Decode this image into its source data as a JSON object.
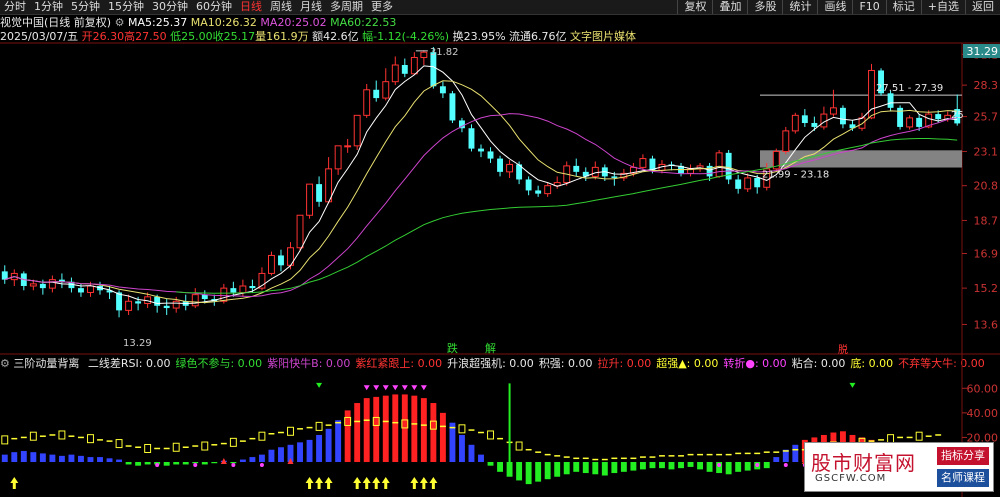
{
  "tabs": [
    {
      "label": "分时",
      "active": false
    },
    {
      "label": "1分钟",
      "active": false
    },
    {
      "label": "5分钟",
      "active": false
    },
    {
      "label": "15分钟",
      "active": false
    },
    {
      "label": "30分钟",
      "active": false
    },
    {
      "label": "60分钟",
      "active": false
    },
    {
      "label": "日线",
      "active": true
    },
    {
      "label": "周线",
      "active": false
    },
    {
      "label": "月线",
      "active": false
    },
    {
      "label": "多周期",
      "active": false
    },
    {
      "label": "更多",
      "active": false
    }
  ],
  "tools": [
    "复权",
    "叠加",
    "多股",
    "统计",
    "画线",
    "F10",
    "标记",
    "+自选",
    "返回"
  ],
  "title": {
    "name": "视觉中国(日线 前复权)",
    "ma5_label": "MA5:",
    "ma5": "25.37",
    "ma10_label": "MA10:",
    "ma10": "26.32",
    "ma20_label": "MA20:",
    "ma20": "25.02",
    "ma60_label": "MA60:",
    "ma60": "22.53"
  },
  "quote": {
    "date": "2025/03/07/五",
    "open_label": "开",
    "open": "26.30",
    "high_label": "高",
    "high": "27.50",
    "low_label": "低",
    "low": "25.00",
    "close_label": "收",
    "close": "25.17",
    "vol_label": "量",
    "vol": "161.9万",
    "amt_label": "额",
    "amt": "42.6亿",
    "chg_label": "幅",
    "chg": "-1.12(-4.26%)",
    "turn_label": "换",
    "turn": "23.95%",
    "float_label": "流通",
    "float": "6.76亿",
    "concept": "文字图片媒体"
  },
  "indicator": {
    "name": "三阶动量背离",
    "items": [
      {
        "label": "二线差RSI: 0.00",
        "color": "#e8e8e8"
      },
      {
        "label": "绿色不参与: 0.00",
        "color": "#33dd33"
      },
      {
        "label": "紫阳快牛B: 0.00",
        "color": "#cc44cc"
      },
      {
        "label": "紫红紧跟上: 0.00",
        "color": "#ff3333"
      },
      {
        "label": "升浪超强机: 0.00",
        "color": "#e8e8e8"
      },
      {
        "label": "积强: 0.00",
        "color": "#e8e8e8"
      },
      {
        "label": "拉升: 0.00",
        "color": "#ff3333"
      },
      {
        "label": "超强▲: 0.00",
        "color": "#ffff33"
      },
      {
        "label": "转折●: 0.00",
        "color": "#ff44ff"
      },
      {
        "label": "粘合: 0.00",
        "color": "#e8e8e8"
      },
      {
        "label": "底: 0.00",
        "color": "#ffff33"
      },
      {
        "label": "不弃等大牛: 0.00",
        "color": "#ff3333"
      }
    ]
  },
  "price_axis": {
    "ticks": [
      "31.1",
      "28.3",
      "25.7",
      "23.1",
      "20.8",
      "18.7",
      "16.9",
      "15.2",
      "13.6"
    ],
    "current": "31.29"
  },
  "ind_axis": {
    "ticks": [
      "60.00",
      "40.00",
      "20.00"
    ]
  },
  "annotations": {
    "high": "31.82",
    "low": "13.29",
    "box_top": "27.51 - 27.39",
    "box_bottom": "21.99 - 23.18",
    "last": "25",
    "sig1": "跌",
    "sig2": "解",
    "sig3": "脱"
  },
  "logo": {
    "big": "股市财富网",
    "url": "GSCFW.COM",
    "btn1": "指标分享",
    "btn2": "名师课程"
  },
  "colors": {
    "up": "#ff3232",
    "down": "#54ffff",
    "ma5": "#ffffff",
    "ma10": "#e8e070",
    "ma20": "#cc44cc",
    "ma60": "#33cc33"
  },
  "chart_data": {
    "type": "candlestick",
    "period": "日线",
    "ylim": [
      12.5,
      32
    ],
    "candles": [
      {
        "o": 16.0,
        "c": 15.6,
        "h": 16.3,
        "l": 15.4
      },
      {
        "o": 15.6,
        "c": 15.9,
        "h": 16.1,
        "l": 15.3
      },
      {
        "o": 15.9,
        "c": 15.3,
        "h": 16.0,
        "l": 15.1
      },
      {
        "o": 15.3,
        "c": 15.4,
        "h": 15.6,
        "l": 15.1
      },
      {
        "o": 15.4,
        "c": 15.2,
        "h": 15.6,
        "l": 14.9
      },
      {
        "o": 15.2,
        "c": 15.6,
        "h": 15.8,
        "l": 15.0
      },
      {
        "o": 15.6,
        "c": 15.5,
        "h": 15.9,
        "l": 15.2
      },
      {
        "o": 15.5,
        "c": 15.2,
        "h": 15.7,
        "l": 15.0
      },
      {
        "o": 15.2,
        "c": 15.0,
        "h": 15.4,
        "l": 14.8
      },
      {
        "o": 15.0,
        "c": 15.3,
        "h": 15.5,
        "l": 14.8
      },
      {
        "o": 15.3,
        "c": 15.1,
        "h": 15.5,
        "l": 14.9
      },
      {
        "o": 15.1,
        "c": 15.0,
        "h": 15.3,
        "l": 14.7
      },
      {
        "o": 15.0,
        "c": 14.2,
        "h": 15.1,
        "l": 13.9
      },
      {
        "o": 14.2,
        "c": 14.6,
        "h": 14.9,
        "l": 14.0
      },
      {
        "o": 14.6,
        "c": 14.5,
        "h": 14.8,
        "l": 14.2
      },
      {
        "o": 14.5,
        "c": 14.8,
        "h": 15.0,
        "l": 14.3
      },
      {
        "o": 14.8,
        "c": 14.4,
        "h": 14.9,
        "l": 14.1
      },
      {
        "o": 14.4,
        "c": 14.3,
        "h": 14.7,
        "l": 14.0
      },
      {
        "o": 14.3,
        "c": 14.6,
        "h": 14.8,
        "l": 14.1
      },
      {
        "o": 14.6,
        "c": 14.4,
        "h": 14.9,
        "l": 14.2
      },
      {
        "o": 14.4,
        "c": 14.9,
        "h": 15.2,
        "l": 14.3
      },
      {
        "o": 14.9,
        "c": 14.7,
        "h": 15.1,
        "l": 14.5
      },
      {
        "o": 14.7,
        "c": 14.6,
        "h": 14.9,
        "l": 14.4
      },
      {
        "o": 14.6,
        "c": 15.2,
        "h": 15.4,
        "l": 14.5
      },
      {
        "o": 15.2,
        "c": 15.0,
        "h": 15.5,
        "l": 14.8
      },
      {
        "o": 15.0,
        "c": 15.3,
        "h": 15.6,
        "l": 14.8
      },
      {
        "o": 15.3,
        "c": 15.2,
        "h": 15.6,
        "l": 15.0
      },
      {
        "o": 15.2,
        "c": 15.9,
        "h": 16.2,
        "l": 15.1
      },
      {
        "o": 15.9,
        "c": 16.8,
        "h": 17.0,
        "l": 15.8
      },
      {
        "o": 16.8,
        "c": 16.3,
        "h": 17.1,
        "l": 16.0
      },
      {
        "o": 16.3,
        "c": 17.2,
        "h": 17.5,
        "l": 16.1
      },
      {
        "o": 17.2,
        "c": 19.0,
        "h": 19.0,
        "l": 17.0
      },
      {
        "o": 19.0,
        "c": 20.9,
        "h": 20.9,
        "l": 18.8
      },
      {
        "o": 20.9,
        "c": 19.8,
        "h": 21.4,
        "l": 19.5
      },
      {
        "o": 19.8,
        "c": 21.9,
        "h": 22.7,
        "l": 19.7
      },
      {
        "o": 21.9,
        "c": 23.5,
        "h": 23.5,
        "l": 21.5
      },
      {
        "o": 23.5,
        "c": 23.5,
        "h": 24.0,
        "l": 23.0
      },
      {
        "o": 23.5,
        "c": 25.8,
        "h": 25.8,
        "l": 23.2
      },
      {
        "o": 25.8,
        "c": 27.9,
        "h": 28.4,
        "l": 25.6
      },
      {
        "o": 27.9,
        "c": 27.2,
        "h": 28.7,
        "l": 26.9
      },
      {
        "o": 27.2,
        "c": 28.6,
        "h": 29.8,
        "l": 27.0
      },
      {
        "o": 28.6,
        "c": 30.1,
        "h": 30.9,
        "l": 28.3
      },
      {
        "o": 30.1,
        "c": 29.3,
        "h": 30.7,
        "l": 29.0
      },
      {
        "o": 29.3,
        "c": 30.8,
        "h": 31.3,
        "l": 29.2
      },
      {
        "o": 30.8,
        "c": 31.3,
        "h": 31.5,
        "l": 30.1
      },
      {
        "o": 31.3,
        "c": 28.2,
        "h": 31.8,
        "l": 28.0
      },
      {
        "o": 28.2,
        "c": 27.6,
        "h": 28.6,
        "l": 27.2
      },
      {
        "o": 27.6,
        "c": 25.4,
        "h": 27.8,
        "l": 25.2
      },
      {
        "o": 25.4,
        "c": 24.8,
        "h": 25.6,
        "l": 24.5
      },
      {
        "o": 24.8,
        "c": 23.3,
        "h": 25.1,
        "l": 23.1
      },
      {
        "o": 23.3,
        "c": 23.1,
        "h": 23.6,
        "l": 22.7
      },
      {
        "o": 23.1,
        "c": 22.6,
        "h": 23.4,
        "l": 22.3
      },
      {
        "o": 22.6,
        "c": 21.7,
        "h": 22.8,
        "l": 21.4
      },
      {
        "o": 21.7,
        "c": 22.2,
        "h": 22.5,
        "l": 21.3
      },
      {
        "o": 22.2,
        "c": 21.2,
        "h": 22.4,
        "l": 20.9
      },
      {
        "o": 21.2,
        "c": 20.5,
        "h": 21.4,
        "l": 20.2
      },
      {
        "o": 20.5,
        "c": 20.3,
        "h": 20.8,
        "l": 20.1
      },
      {
        "o": 20.3,
        "c": 20.8,
        "h": 21.0,
        "l": 20.1
      },
      {
        "o": 20.8,
        "c": 21.0,
        "h": 21.4,
        "l": 20.6
      },
      {
        "o": 21.0,
        "c": 22.1,
        "h": 22.4,
        "l": 20.8
      },
      {
        "o": 22.1,
        "c": 21.7,
        "h": 22.6,
        "l": 21.4
      },
      {
        "o": 21.7,
        "c": 21.4,
        "h": 22.0,
        "l": 21.1
      },
      {
        "o": 21.4,
        "c": 22.0,
        "h": 22.4,
        "l": 21.2
      },
      {
        "o": 22.0,
        "c": 21.4,
        "h": 22.2,
        "l": 21.1
      },
      {
        "o": 21.4,
        "c": 21.3,
        "h": 21.7,
        "l": 20.8
      },
      {
        "o": 21.3,
        "c": 21.6,
        "h": 21.9,
        "l": 21.1
      },
      {
        "o": 21.6,
        "c": 22.0,
        "h": 22.3,
        "l": 21.4
      },
      {
        "o": 22.0,
        "c": 22.6,
        "h": 22.9,
        "l": 21.8
      },
      {
        "o": 22.6,
        "c": 21.8,
        "h": 22.8,
        "l": 21.6
      },
      {
        "o": 21.8,
        "c": 22.2,
        "h": 22.5,
        "l": 21.6
      },
      {
        "o": 22.2,
        "c": 22.1,
        "h": 22.4,
        "l": 21.8
      },
      {
        "o": 22.1,
        "c": 21.6,
        "h": 22.3,
        "l": 21.4
      },
      {
        "o": 21.6,
        "c": 21.9,
        "h": 22.2,
        "l": 21.4
      },
      {
        "o": 21.9,
        "c": 22.1,
        "h": 22.3,
        "l": 21.7
      },
      {
        "o": 22.1,
        "c": 21.4,
        "h": 22.3,
        "l": 21.1
      },
      {
        "o": 21.4,
        "c": 23.0,
        "h": 23.2,
        "l": 21.3
      },
      {
        "o": 23.0,
        "c": 21.2,
        "h": 23.2,
        "l": 20.9
      },
      {
        "o": 21.2,
        "c": 20.6,
        "h": 21.5,
        "l": 20.3
      },
      {
        "o": 20.6,
        "c": 21.3,
        "h": 21.6,
        "l": 20.4
      },
      {
        "o": 21.3,
        "c": 20.7,
        "h": 21.5,
        "l": 20.3
      },
      {
        "o": 20.7,
        "c": 21.9,
        "h": 22.3,
        "l": 20.5
      },
      {
        "o": 21.9,
        "c": 23.1,
        "h": 23.3,
        "l": 21.7
      },
      {
        "o": 23.1,
        "c": 24.6,
        "h": 24.9,
        "l": 22.9
      },
      {
        "o": 24.6,
        "c": 25.8,
        "h": 26.0,
        "l": 24.4
      },
      {
        "o": 25.8,
        "c": 25.2,
        "h": 26.3,
        "l": 24.9
      },
      {
        "o": 25.2,
        "c": 24.9,
        "h": 25.7,
        "l": 24.6
      },
      {
        "o": 24.9,
        "c": 25.9,
        "h": 26.5,
        "l": 24.7
      },
      {
        "o": 25.9,
        "c": 26.4,
        "h": 27.9,
        "l": 25.7
      },
      {
        "o": 26.4,
        "c": 25.1,
        "h": 26.6,
        "l": 24.8
      },
      {
        "o": 25.1,
        "c": 24.8,
        "h": 25.4,
        "l": 24.6
      },
      {
        "o": 24.8,
        "c": 25.6,
        "h": 26.0,
        "l": 24.6
      },
      {
        "o": 25.6,
        "c": 29.6,
        "h": 30.2,
        "l": 25.5
      },
      {
        "o": 29.6,
        "c": 27.6,
        "h": 29.8,
        "l": 27.4
      },
      {
        "o": 27.6,
        "c": 26.4,
        "h": 27.8,
        "l": 26.1
      },
      {
        "o": 26.4,
        "c": 24.9,
        "h": 26.6,
        "l": 24.7
      },
      {
        "o": 24.9,
        "c": 25.6,
        "h": 25.8,
        "l": 24.7
      },
      {
        "o": 25.6,
        "c": 24.9,
        "h": 25.9,
        "l": 24.6
      },
      {
        "o": 24.9,
        "c": 25.9,
        "h": 26.2,
        "l": 24.8
      },
      {
        "o": 25.9,
        "c": 25.5,
        "h": 26.2,
        "l": 25.2
      },
      {
        "o": 25.5,
        "c": 25.8,
        "h": 26.1,
        "l": 25.3
      },
      {
        "o": 26.3,
        "c": 25.17,
        "h": 27.5,
        "l": 25.0
      }
    ],
    "indicator": {
      "ylim": [
        0,
        70
      ],
      "hist": [
        6,
        8,
        9,
        8,
        7,
        6,
        5,
        6,
        5,
        4,
        4,
        3,
        2,
        -2,
        -3,
        -2,
        -2,
        -3,
        -2,
        -2,
        -1,
        -2,
        -1,
        1,
        -1,
        2,
        4,
        6,
        10,
        12,
        14,
        16,
        18,
        22,
        27,
        34,
        42,
        48,
        52,
        53,
        54,
        55,
        55,
        54,
        52,
        48,
        40,
        32,
        22,
        14,
        6,
        -3,
        -8,
        -12,
        -15,
        -18,
        -16,
        -14,
        -12,
        -10,
        -8,
        -9,
        -10,
        -11,
        -9,
        -8,
        -7,
        -6,
        -5,
        -5,
        -6,
        -5,
        -4,
        -6,
        -8,
        -9,
        -10,
        -8,
        -7,
        -6,
        -5,
        4,
        10,
        14,
        18,
        20,
        22,
        24,
        25,
        22,
        20,
        18,
        16,
        14,
        12,
        10,
        8,
        6,
        6
      ],
      "line": [
        18,
        19,
        20,
        21,
        21,
        22,
        22,
        21,
        20,
        19,
        18,
        17,
        15,
        13,
        12,
        11,
        11,
        11,
        12,
        12,
        13,
        13,
        14,
        15,
        16,
        17,
        19,
        21,
        23,
        24,
        25,
        27,
        28,
        29,
        30,
        32,
        33,
        33,
        34,
        33,
        33,
        32,
        31,
        31,
        30,
        30,
        29,
        28,
        27,
        26,
        24,
        22,
        19,
        16,
        13,
        10,
        8,
        6,
        5,
        4,
        3,
        3,
        2,
        2,
        3,
        3,
        3,
        4,
        4,
        5,
        5,
        5,
        6,
        6,
        6,
        6,
        6,
        7,
        7,
        7,
        8,
        8,
        9,
        10,
        10,
        11,
        12,
        13,
        14,
        15,
        16,
        17,
        18,
        19,
        20,
        20,
        21,
        21,
        22
      ]
    }
  }
}
